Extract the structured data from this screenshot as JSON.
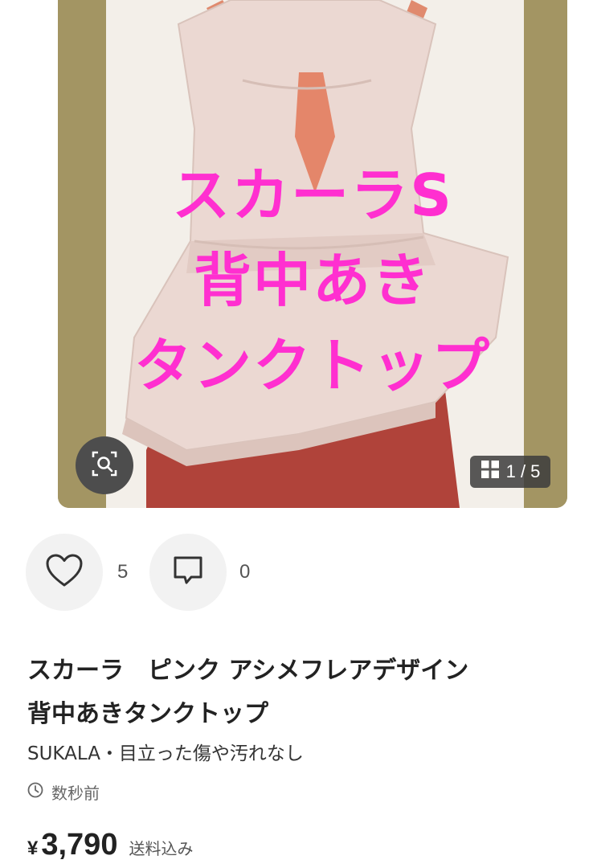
{
  "photo": {
    "overlay_lines": [
      "スカーラS",
      "背中あき",
      "タンクトップ"
    ],
    "counter": "1 / 5",
    "counter_icon": "grid-icon",
    "lens_icon": "image-search-icon",
    "overlay_color": "#ff2fd0"
  },
  "actions": {
    "like_icon": "heart-icon",
    "like_count": "5",
    "comment_icon": "comment-icon",
    "comment_count": "0"
  },
  "item": {
    "title_line1": "スカーラ　ピンク アシメフレアデザイン",
    "title_line2": "背中あきタンクトップ",
    "meta": "SUKALA・目立った傷や汚れなし",
    "timestamp": "数秒前",
    "timestamp_icon": "clock-icon",
    "price_currency": "¥",
    "price": "3,790",
    "shipping": "送料込み"
  }
}
